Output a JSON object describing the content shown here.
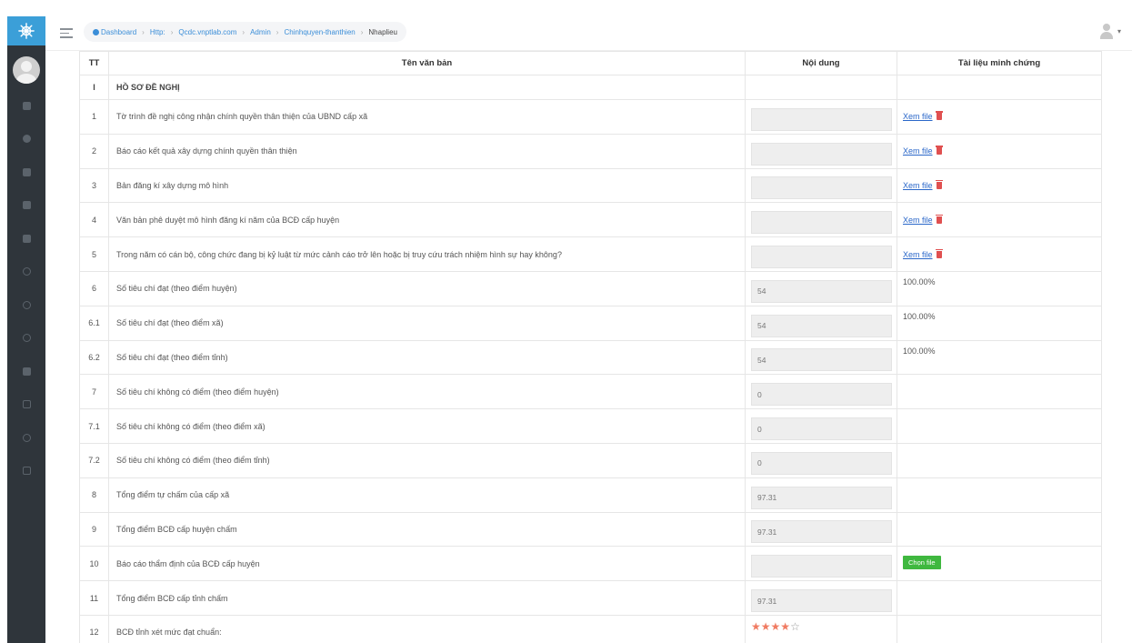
{
  "breadcrumb": [
    {
      "label": "Dashboard"
    },
    {
      "label": "Http:"
    },
    {
      "label": "Qcdc.vnptlab.com"
    },
    {
      "label": "Admin"
    },
    {
      "label": "Chinhquyen-thanthien"
    },
    {
      "label": "Nhaplieu"
    }
  ],
  "table": {
    "headers": {
      "tt": "TT",
      "name": "Tên văn bản",
      "content": "Nội dung",
      "doc": "Tài liệu minh chứng"
    },
    "section": {
      "tt": "I",
      "name": "HỒ SƠ ĐỀ NGHỊ"
    },
    "rows": [
      {
        "tt": "1",
        "name": "Tờ trình đề nghị công nhận chính quyền thân thiện của UBND cấp xã",
        "value": "",
        "doc": "Xem file"
      },
      {
        "tt": "2",
        "name": "Báo cáo kết quả xây dựng chính quyền thân thiện",
        "value": "",
        "doc": "Xem file"
      },
      {
        "tt": "3",
        "name": "Bản đăng kí xây dựng mô hình",
        "value": "",
        "doc": "Xem file"
      },
      {
        "tt": "4",
        "name": "Văn bản phê duyệt mô hình đăng kí năm của BCĐ cấp huyện",
        "value": "",
        "doc": "Xem file"
      },
      {
        "tt": "5",
        "name": "Trong năm có cán bộ, công chức đang bị kỷ luật từ mức cảnh cáo trở lên hoặc bị truy cứu trách nhiệm hình sự hay không?",
        "value": "",
        "doc": "Xem file"
      },
      {
        "tt": "6",
        "name": "Số tiêu chí đạt (theo điểm huyện)",
        "value": "54",
        "pct": "100.00%"
      },
      {
        "tt": "6.1",
        "name": "Số tiêu chí đạt (theo điểm xã)",
        "value": "54",
        "pct": "100.00%"
      },
      {
        "tt": "6.2",
        "name": "Số tiêu chí đạt (theo điểm tỉnh)",
        "value": "54",
        "pct": "100.00%"
      },
      {
        "tt": "7",
        "name": "Số tiêu chí không có điểm (theo điểm huyện)",
        "value": "0"
      },
      {
        "tt": "7.1",
        "name": "Số tiêu chí không có điểm (theo điểm xã)",
        "value": "0"
      },
      {
        "tt": "7.2",
        "name": "Số tiêu chí không có điểm (theo điểm tỉnh)",
        "value": "0"
      },
      {
        "tt": "8",
        "name": "Tổng điểm tự chấm của cấp xã",
        "value": "97.31"
      },
      {
        "tt": "9",
        "name": "Tổng điểm BCĐ cấp huyện chấm",
        "value": "97.31"
      },
      {
        "tt": "10",
        "name": "Báo cáo thẩm định của BCĐ cấp huyện",
        "value": "",
        "button": "Chọn file"
      },
      {
        "tt": "11",
        "name": "Tổng điểm BCĐ cấp tỉnh chấm",
        "value": "97.31"
      },
      {
        "tt": "12",
        "name": "BCĐ tỉnh xét mức đạt chuẩn:",
        "rating": 4,
        "rating_max": 5
      }
    ]
  },
  "icons": {
    "logo": "ship-wheel-icon",
    "menu": "hamburger-icon",
    "user": "user-icon",
    "delete": "trash-icon",
    "star": "star-icon"
  },
  "colors": {
    "sidebar": "#2f353b",
    "logo_bg": "#3b9fd8",
    "link": "#2a67c9",
    "button": "#3fb83f",
    "star": "#f07b62",
    "trash": "#e05050"
  }
}
